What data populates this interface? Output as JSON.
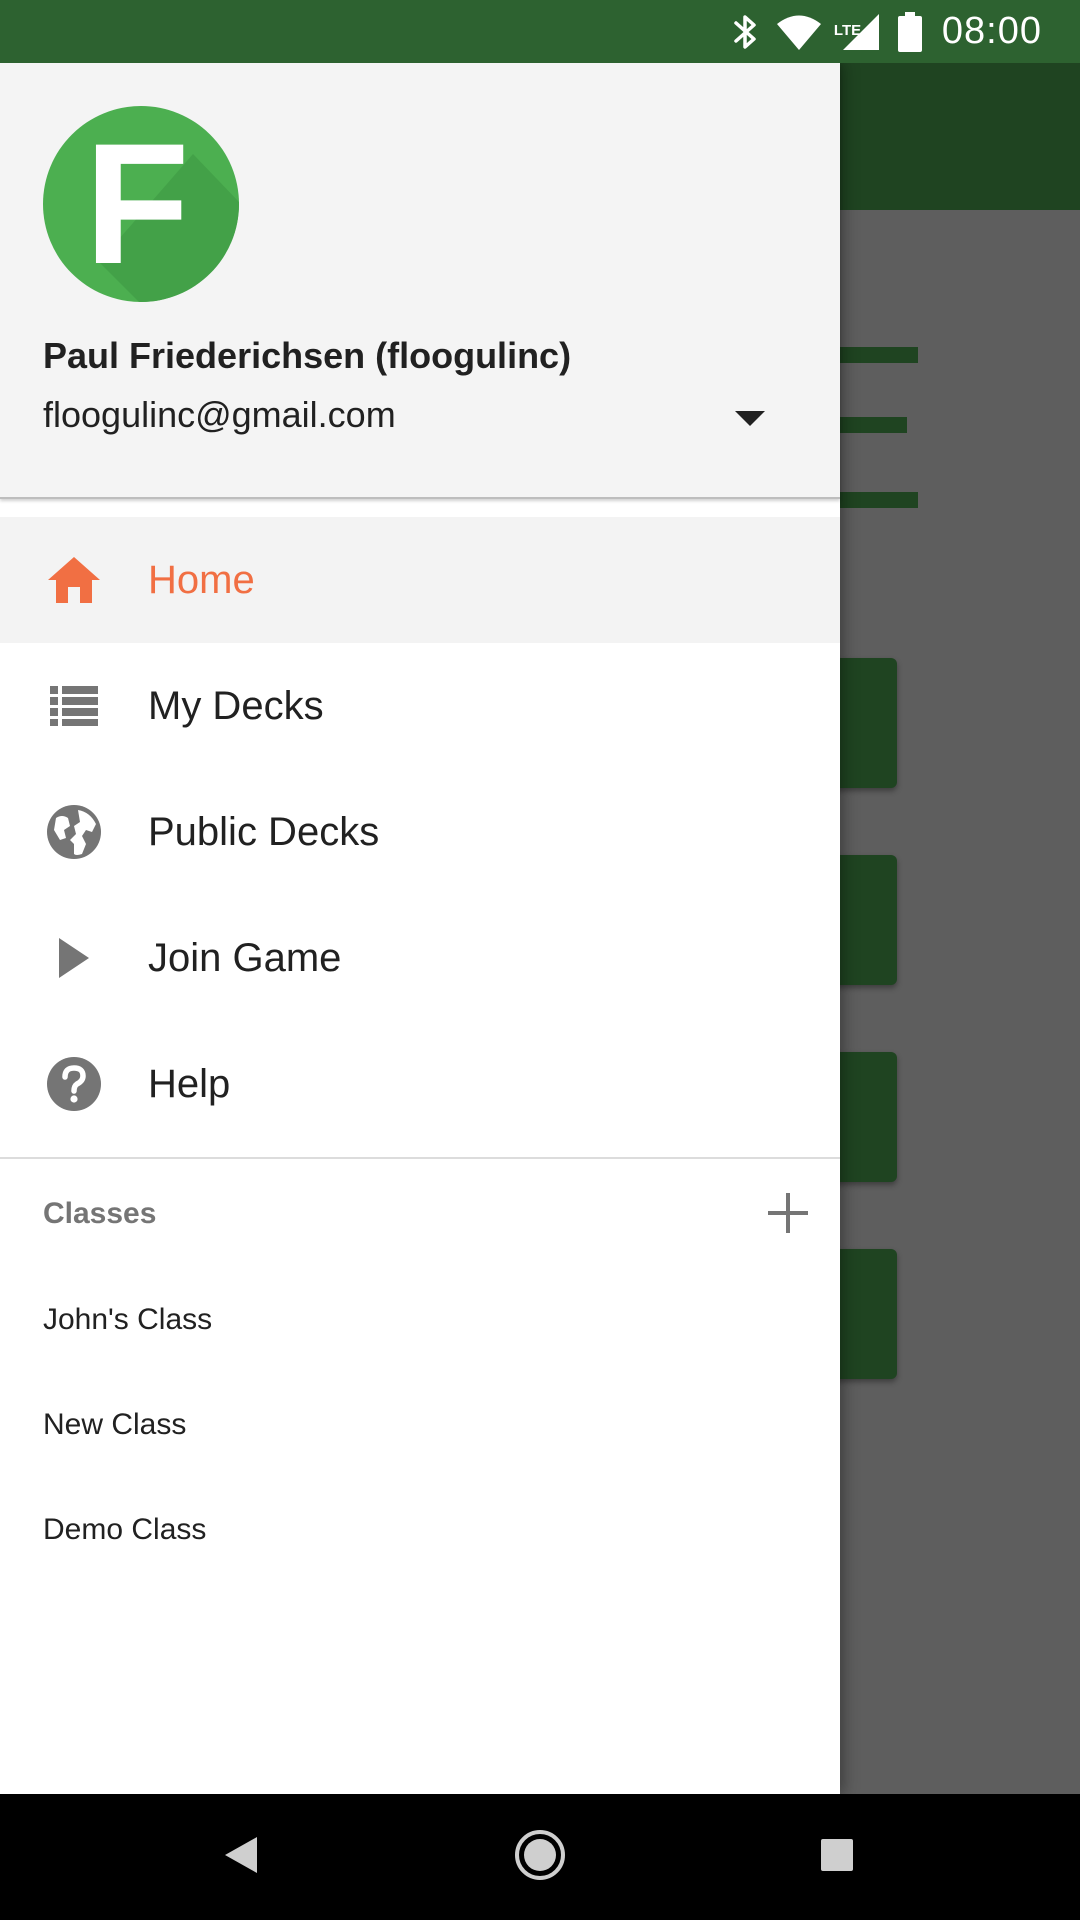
{
  "status_bar": {
    "time": "08:00",
    "icons": [
      "bluetooth-icon",
      "wifi-icon",
      "lte-signal-icon",
      "battery-icon"
    ],
    "network_label": "LTE"
  },
  "drawer": {
    "header": {
      "avatar_letter": "F",
      "avatar_color": "#4caf50",
      "user_name": "Paul Friederichsen (floogulinc)",
      "user_email": "floogulinc@gmail.com"
    },
    "nav_items": [
      {
        "label": "Home",
        "icon": "home-icon",
        "active": true
      },
      {
        "label": "My Decks",
        "icon": "list-icon",
        "active": false
      },
      {
        "label": "Public Decks",
        "icon": "globe-icon",
        "active": false
      },
      {
        "label": "Join Game",
        "icon": "play-icon",
        "active": false
      },
      {
        "label": "Help",
        "icon": "help-icon",
        "active": false
      }
    ],
    "classes_section": {
      "title": "Classes",
      "items": [
        "John's Class",
        "New Class",
        "Demo Class"
      ]
    }
  },
  "colors": {
    "accent": "#f16f43",
    "status_bar": "#2d6230",
    "app_bar": "#1f4421",
    "scrim": "#5e5e5e"
  },
  "system_nav": {
    "buttons": [
      "back-icon",
      "home-circle-icon",
      "recents-icon"
    ]
  }
}
